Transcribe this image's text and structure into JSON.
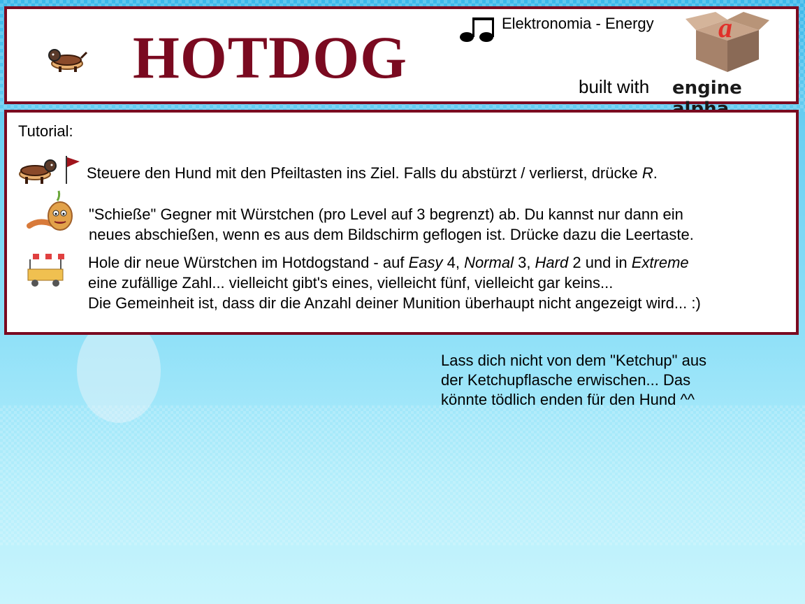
{
  "header": {
    "title": "HOTDOG",
    "music": "Elektronomia - Energy",
    "built_with": "built with",
    "engine": "engine alpha"
  },
  "tutorial": {
    "label": "Tutorial:",
    "line1": {
      "a": "Steuere den Hund mit den Pfeiltasten ins Ziel.",
      "b": "Falls du abstürzt / verlierst, drücke ",
      "key": "R",
      "end": "."
    },
    "line2": {
      "row1": "\"Schieße\" Gegner mit Würstchen (pro Level auf 3 begrenzt) ab. Du kannst nur dann ein",
      "row2": "neues abschießen, wenn es aus dem Bildschirm geflogen ist. Drücke dazu die Leertaste."
    },
    "line3": {
      "p1": "Hole dir neue Würstchen im Hotdogstand - auf ",
      "easy": "Easy",
      "easy_n": " 4, ",
      "normal": "Normal",
      "normal_n": " 3, ",
      "hard": "Hard",
      "hard_n": " 2 und in ",
      "extreme": "Extreme",
      "row2": "eine zufällige Zahl... vielleicht gibt's eines, vielleicht fünf, vielleicht gar keins...",
      "row3": "Die Gemeinheit ist, dass dir die Anzahl deiner Munition überhaupt nicht angezeigt wird... :)"
    }
  },
  "hint": {
    "row1": "Lass dich nicht von dem \"Ketchup\" aus",
    "row2": "der Ketchupflasche erwischen... Das",
    "row3": "könnte tödlich enden für den Hund ^^"
  },
  "colors": {
    "accent": "#7a0a20",
    "panel_bg": "#ffffff",
    "sky": "#6cd0f2"
  },
  "icons": [
    "hotdog-dog-icon",
    "music-notes-icon",
    "engine-alpha-logo",
    "goal-flag-icon",
    "onion-enemy-icon",
    "sausage-icon",
    "hotdog-stand-icon"
  ]
}
